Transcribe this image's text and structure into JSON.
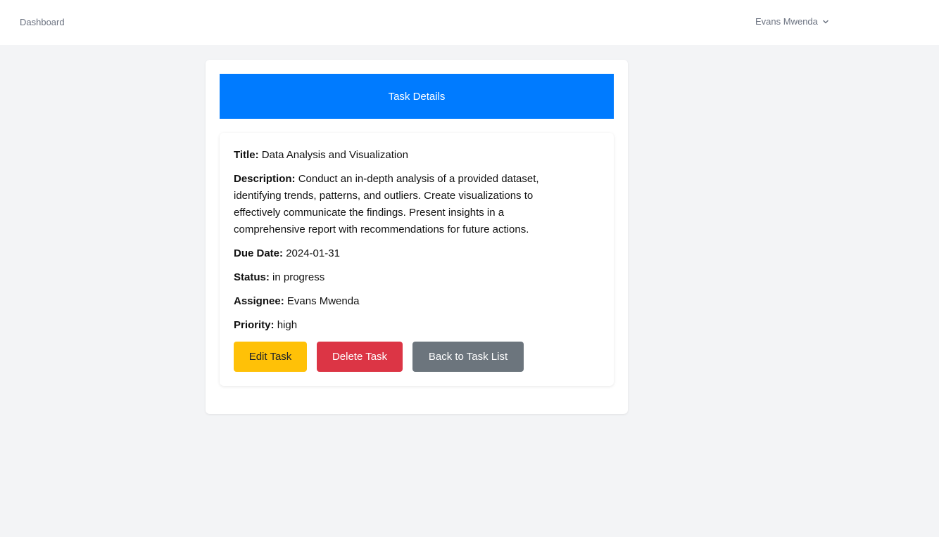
{
  "nav": {
    "dashboard_label": "Dashboard",
    "user_name": "Evans Mwenda",
    "user_menu_icon": "chevron-down-icon"
  },
  "card": {
    "header_title": "Task Details",
    "header_color": "#007bff"
  },
  "task": {
    "title_label": "Title:",
    "title_value": "Data Analysis and Visualization",
    "description_label": "Description:",
    "description_value": "Conduct an in-depth analysis of a provided dataset, identifying trends, patterns, and outliers. Create visualizations to effectively communicate the findings. Present insights in a comprehensive report with recommendations for future actions.",
    "due_date_label": "Due Date:",
    "due_date_value": "2024-01-31",
    "status_label": "Status:",
    "status_value": "in progress",
    "assignee_label": "Assignee:",
    "assignee_value": "Evans Mwenda",
    "priority_label": "Priority:",
    "priority_value": "high"
  },
  "actions": {
    "edit_label": "Edit Task",
    "edit_color": "#ffc107",
    "delete_label": "Delete Task",
    "delete_color": "#dc3545",
    "back_label": "Back to Task List",
    "back_color": "#6c757d"
  }
}
